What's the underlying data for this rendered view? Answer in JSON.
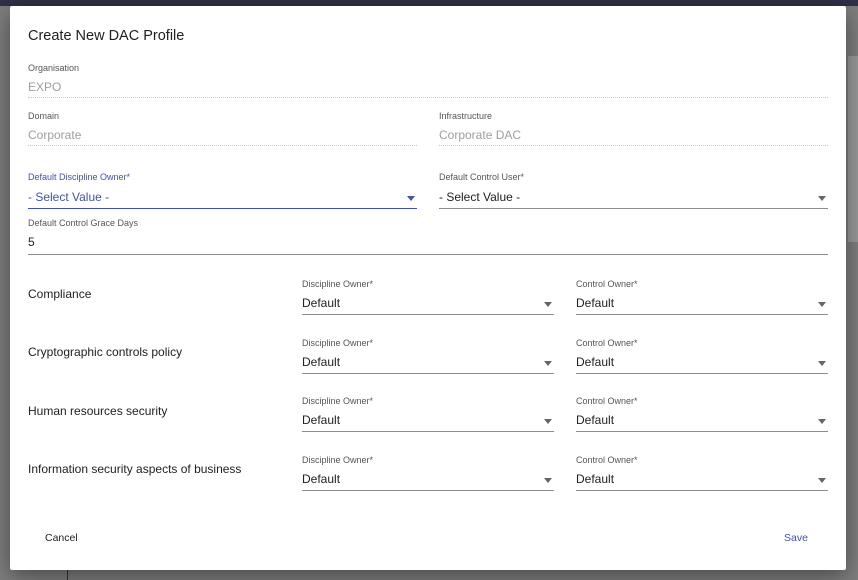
{
  "dialog": {
    "title": "Create New DAC Profile",
    "organisation": {
      "label": "Organisation",
      "value": "EXPO"
    },
    "domain": {
      "label": "Domain",
      "value": "Corporate"
    },
    "infrastructure": {
      "label": "Infrastructure",
      "value": "Corporate DAC"
    },
    "default_discipline_owner": {
      "label": "Default Discipline Owner*",
      "value": "- Select Value -"
    },
    "default_control_user": {
      "label": "Default Control User*",
      "value": "- Select Value -"
    },
    "grace_days": {
      "label": "Default Control Grace Days",
      "value": "5"
    },
    "rows": [
      {
        "name": "Compliance",
        "discipline_label": "Discipline Owner*",
        "discipline_value": "Default",
        "control_label": "Control Owner*",
        "control_value": "Default"
      },
      {
        "name": "Cryptographic controls policy",
        "discipline_label": "Discipline Owner*",
        "discipline_value": "Default",
        "control_label": "Control Owner*",
        "control_value": "Default"
      },
      {
        "name": "Human resources security",
        "discipline_label": "Discipline Owner*",
        "discipline_value": "Default",
        "control_label": "Control Owner*",
        "control_value": "Default"
      },
      {
        "name": "Information security aspects of business",
        "discipline_label": "Discipline Owner*",
        "discipline_value": "Default",
        "control_label": "Control Owner*",
        "control_value": "Default"
      }
    ],
    "cancel_label": "Cancel",
    "save_label": "Save"
  }
}
